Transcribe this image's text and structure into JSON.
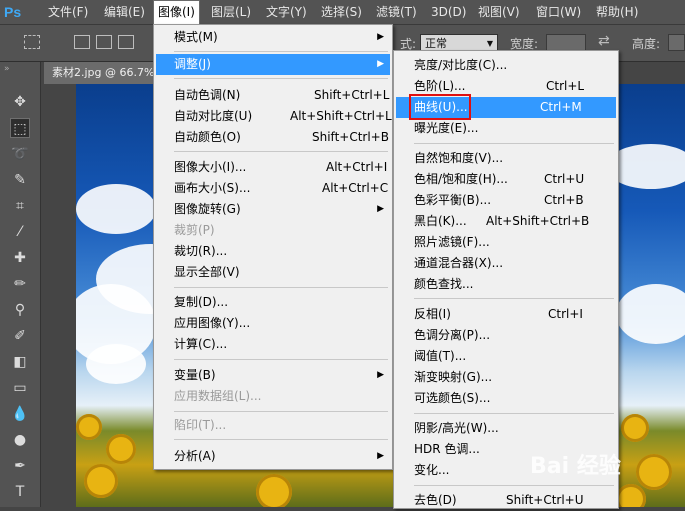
{
  "app": {
    "logo": "Ps"
  },
  "menubar": {
    "items": [
      "文件(F)",
      "编辑(E)",
      "图像(I)",
      "图层(L)",
      "文字(Y)",
      "选择(S)",
      "滤镜(T)",
      "3D(D)",
      "视图(V)",
      "窗口(W)",
      "帮助(H)"
    ],
    "active_index": 2
  },
  "options": {
    "style_label": "式:",
    "style_value": "正常",
    "width_label": "宽度:",
    "height_label": "高度:"
  },
  "document": {
    "tab_title": "素材2.jpg @ 66.7%"
  },
  "image_menu": {
    "items": [
      {
        "label": "模式(M)",
        "shortcut": "",
        "submenu": true,
        "disabled": false
      },
      {
        "label": "调整(J)",
        "shortcut": "",
        "submenu": true,
        "disabled": false,
        "highlighted": true
      },
      {
        "label": "自动色调(N)",
        "shortcut": "Shift+Ctrl+L"
      },
      {
        "label": "自动对比度(U)",
        "shortcut": "Alt+Shift+Ctrl+L"
      },
      {
        "label": "自动颜色(O)",
        "shortcut": "Shift+Ctrl+B"
      },
      {
        "label": "图像大小(I)...",
        "shortcut": "Alt+Ctrl+I"
      },
      {
        "label": "画布大小(S)...",
        "shortcut": "Alt+Ctrl+C"
      },
      {
        "label": "图像旋转(G)",
        "shortcut": "",
        "submenu": true
      },
      {
        "label": "裁剪(P)",
        "shortcut": "",
        "disabled": true
      },
      {
        "label": "裁切(R)...",
        "shortcut": ""
      },
      {
        "label": "显示全部(V)",
        "shortcut": ""
      },
      {
        "label": "复制(D)...",
        "shortcut": ""
      },
      {
        "label": "应用图像(Y)...",
        "shortcut": ""
      },
      {
        "label": "计算(C)...",
        "shortcut": ""
      },
      {
        "label": "变量(B)",
        "shortcut": "",
        "submenu": true
      },
      {
        "label": "应用数据组(L)...",
        "shortcut": "",
        "disabled": true
      },
      {
        "label": "陷印(T)...",
        "shortcut": "",
        "disabled": true
      },
      {
        "label": "分析(A)",
        "shortcut": "",
        "submenu": true
      }
    ]
  },
  "adjust_menu": {
    "items": [
      {
        "label": "亮度/对比度(C)...",
        "shortcut": ""
      },
      {
        "label": "色阶(L)...",
        "shortcut": "Ctrl+L"
      },
      {
        "label": "曲线(U)...",
        "shortcut": "Ctrl+M",
        "highlighted": true
      },
      {
        "label": "曝光度(E)...",
        "shortcut": ""
      },
      {
        "label": "自然饱和度(V)...",
        "shortcut": ""
      },
      {
        "label": "色相/饱和度(H)...",
        "shortcut": "Ctrl+U"
      },
      {
        "label": "色彩平衡(B)...",
        "shortcut": "Ctrl+B"
      },
      {
        "label": "黑白(K)...",
        "shortcut": "Alt+Shift+Ctrl+B"
      },
      {
        "label": "照片滤镜(F)...",
        "shortcut": ""
      },
      {
        "label": "通道混合器(X)...",
        "shortcut": ""
      },
      {
        "label": "颜色查找...",
        "shortcut": ""
      },
      {
        "label": "反相(I)",
        "shortcut": "Ctrl+I"
      },
      {
        "label": "色调分离(P)...",
        "shortcut": ""
      },
      {
        "label": "阈值(T)...",
        "shortcut": ""
      },
      {
        "label": "渐变映射(G)...",
        "shortcut": ""
      },
      {
        "label": "可选颜色(S)...",
        "shortcut": ""
      },
      {
        "label": "阴影/高光(W)...",
        "shortcut": ""
      },
      {
        "label": "HDR 色调...",
        "shortcut": ""
      },
      {
        "label": "变化...",
        "shortcut": ""
      },
      {
        "label": "去色(D)",
        "shortcut": "Shift+Ctrl+U"
      }
    ]
  },
  "colors": {
    "highlight": "#3399ff",
    "annotation": "#e01010",
    "menu_bg": "#f0f0f0"
  },
  "watermark": {
    "text": "Bai 经验"
  }
}
